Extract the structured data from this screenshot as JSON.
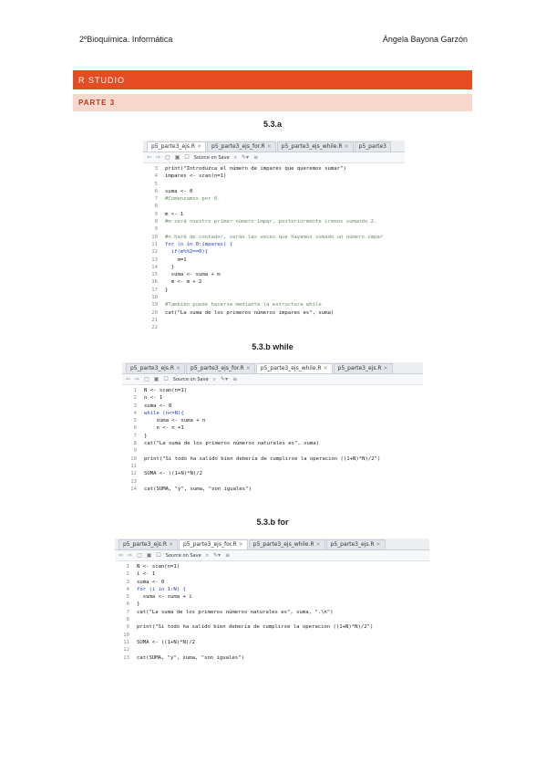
{
  "header": {
    "left": "2ºBioquímica. Informática",
    "right": "Ángela Bayona Garzón"
  },
  "section": {
    "title": "R STUDIO",
    "subtitle": "PARTE 3"
  },
  "colors": {
    "accent": "#e64c24",
    "band_light": "#f8d8cd"
  },
  "figures": [
    {
      "caption": "5.3.a",
      "tabs": [
        "p5_parte3_ejs.R",
        "p5_parte3_ejs_for.R",
        "p5_parte3_ejs_while.R",
        "p5_parte3"
      ],
      "toolbar": {
        "source_on_save": "Source on Save"
      },
      "lines": [
        {
          "n": "3",
          "t": "print(\"Introduzca el número de impares que queremos sumar\")"
        },
        {
          "n": "4",
          "t": "impares <- scan(n=1)"
        },
        {
          "n": "5",
          "t": ""
        },
        {
          "n": "6",
          "t": "suma <- 0"
        },
        {
          "n": "7",
          "t": "#Comenzamos por 0."
        },
        {
          "n": "8",
          "t": ""
        },
        {
          "n": "9",
          "t": "m <- 1"
        },
        {
          "n": "8",
          "t": "#m será nuestro primer número impar, posteriormente iremos sumando 2."
        },
        {
          "n": "9",
          "t": ""
        },
        {
          "n": "10",
          "t": "#n hará de contador, serán las veces que hayamos sumado un número impar"
        },
        {
          "n": "11",
          "t": "for (n in 0:impares) {"
        },
        {
          "n": "12",
          "t": "  if(m%%2==0){"
        },
        {
          "n": "13",
          "t": "    m=1"
        },
        {
          "n": "14",
          "t": "  }"
        },
        {
          "n": "15",
          "t": "  suma <- suma + m"
        },
        {
          "n": "16",
          "t": "  m <- m + 2"
        },
        {
          "n": "17",
          "t": "}"
        },
        {
          "n": "18",
          "t": ""
        },
        {
          "n": "19",
          "t": "#También puede hacerse mediante la estructura while"
        },
        {
          "n": "20",
          "t": "cat(\"La suma de los primeros números impares es\", suma)"
        },
        {
          "n": "21",
          "t": ""
        },
        {
          "n": "22",
          "t": ""
        }
      ]
    },
    {
      "caption": "5.3.b while",
      "tabs": [
        "p5_parte3_ejs.R",
        "p5_parte3_ejs_for.R",
        "p5_parte3_ejs_while.R",
        "p5_parte3_ejs.R"
      ],
      "toolbar": {
        "source_on_save": "Source on Save"
      },
      "lines": [
        {
          "n": "1",
          "t": "N <- scan(n=1)"
        },
        {
          "n": "2",
          "t": "n <- 1"
        },
        {
          "n": "3",
          "t": "suma <- 0"
        },
        {
          "n": "4",
          "t": "while (n<=N){"
        },
        {
          "n": "5",
          "t": "    suma <- suma + n"
        },
        {
          "n": "6",
          "t": "    n <- n +1"
        },
        {
          "n": "7",
          "t": "}"
        },
        {
          "n": "8",
          "t": "cat(\"La suma de los primeros números naturales es\", suma)"
        },
        {
          "n": "9",
          "t": ""
        },
        {
          "n": "10",
          "t": "print(\"Si todo ha salido bien debería de cumplirse la operación ((1+N)*N)/2\")"
        },
        {
          "n": "11",
          "t": ""
        },
        {
          "n": "12",
          "t": "SUMA <- ((1+N)*N)/2"
        },
        {
          "n": "13",
          "t": ""
        },
        {
          "n": "14",
          "t": "cat(SUMA, \"y\", suma, \"son iguales\")"
        }
      ]
    },
    {
      "caption": "5.3.b for",
      "tabs": [
        "p5_parte3_ejs.R",
        "p5_parte3_ejs_for.R",
        "p5_parte3_ejs_while.R",
        "p5_parte3_ejs.R"
      ],
      "toolbar": {
        "source_on_save": "Source on Save"
      },
      "lines": [
        {
          "n": "1",
          "t": "N <- scan(n=1)"
        },
        {
          "n": "2",
          "t": "i <- 1"
        },
        {
          "n": "3",
          "t": "suma <- 0"
        },
        {
          "n": "4",
          "t": "for (i in 1:N) {"
        },
        {
          "n": "5",
          "t": "  suma <- suma + i"
        },
        {
          "n": "6",
          "t": "}"
        },
        {
          "n": "7",
          "t": "cat(\"La suma de los primeros números naturales es\", suma, \".\\n\")"
        },
        {
          "n": "8",
          "t": ""
        },
        {
          "n": "9",
          "t": "print(\"Si todo ha salido bien debería de cumplirse la operación ((1+N)*N)/2\")"
        },
        {
          "n": "10",
          "t": ""
        },
        {
          "n": "11",
          "t": "SUMA <- ((1+N)*N)/2"
        },
        {
          "n": "12",
          "t": ""
        },
        {
          "n": "13",
          "t": "cat(SUMA, \"y\", suma, \"son iguales\")"
        }
      ]
    }
  ]
}
